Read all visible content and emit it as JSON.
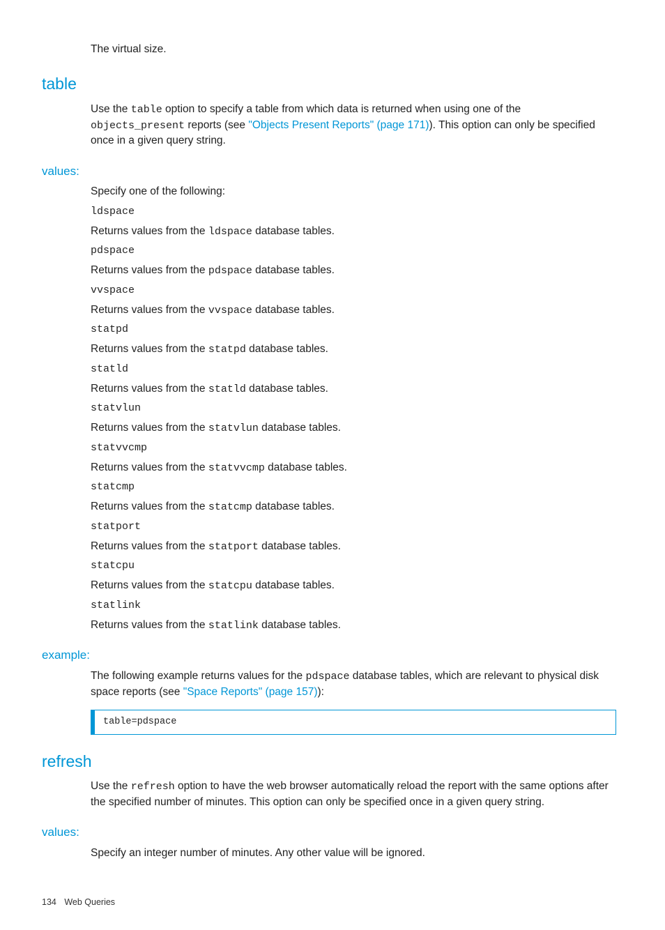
{
  "intro": {
    "virtual_size": "The virtual size."
  },
  "table": {
    "heading": "table",
    "p1_a": "Use the ",
    "p1_code1": "table",
    "p1_b": " option to specify a table from which data is returned when using one of the ",
    "p1_code2": "objects_present",
    "p1_c": " reports (see ",
    "p1_link": "\"Objects Present Reports\" (page 171)",
    "p1_d": "). This option can only be specified once in a given query string.",
    "values_heading": "values:",
    "values_intro": "Specify one of the following:",
    "items": [
      {
        "code": "ldspace",
        "desc_a": "Returns values from the ",
        "desc_code": "ldspace",
        "desc_b": " database tables."
      },
      {
        "code": "pdspace",
        "desc_a": "Returns values from the ",
        "desc_code": "pdspace",
        "desc_b": " database tables."
      },
      {
        "code": "vvspace",
        "desc_a": "Returns values from the ",
        "desc_code": "vvspace",
        "desc_b": " database tables."
      },
      {
        "code": "statpd",
        "desc_a": "Returns values from the ",
        "desc_code": "statpd",
        "desc_b": " database tables."
      },
      {
        "code": "statld",
        "desc_a": "Returns values from the ",
        "desc_code": "statld",
        "desc_b": " database tables."
      },
      {
        "code": "statvlun",
        "desc_a": "Returns values from the ",
        "desc_code": "statvlun",
        "desc_b": " database tables."
      },
      {
        "code": "statvvcmp",
        "desc_a": "Returns values from the ",
        "desc_code": "statvvcmp",
        "desc_b": " database tables."
      },
      {
        "code": "statcmp",
        "desc_a": "Returns values from the ",
        "desc_code": "statcmp",
        "desc_b": " database tables."
      },
      {
        "code": "statport",
        "desc_a": "Returns values from the ",
        "desc_code": "statport",
        "desc_b": " database tables."
      },
      {
        "code": "statcpu",
        "desc_a": "Returns values from the ",
        "desc_code": "statcpu",
        "desc_b": " database tables."
      },
      {
        "code": "statlink",
        "desc_a": "Returns values from the ",
        "desc_code": "statlink",
        "desc_b": " database tables."
      }
    ],
    "example_heading": "example:",
    "ex_a": "The following example returns values for the ",
    "ex_code": "pdspace",
    "ex_b": " database tables, which are relevant to physical disk space reports (see ",
    "ex_link": "\"Space Reports\" (page 157)",
    "ex_c": "):",
    "codebox": "table=pdspace"
  },
  "refresh": {
    "heading": "refresh",
    "p1_a": "Use the ",
    "p1_code": "refresh",
    "p1_b": " option to have the web browser automatically reload the report with the same options after the specified number of minutes. This option can only be specified once in a given query string.",
    "values_heading": "values:",
    "values_text": "Specify an integer number of minutes. Any other value will be ignored."
  },
  "footer": {
    "page": "134",
    "section": "Web Queries"
  }
}
